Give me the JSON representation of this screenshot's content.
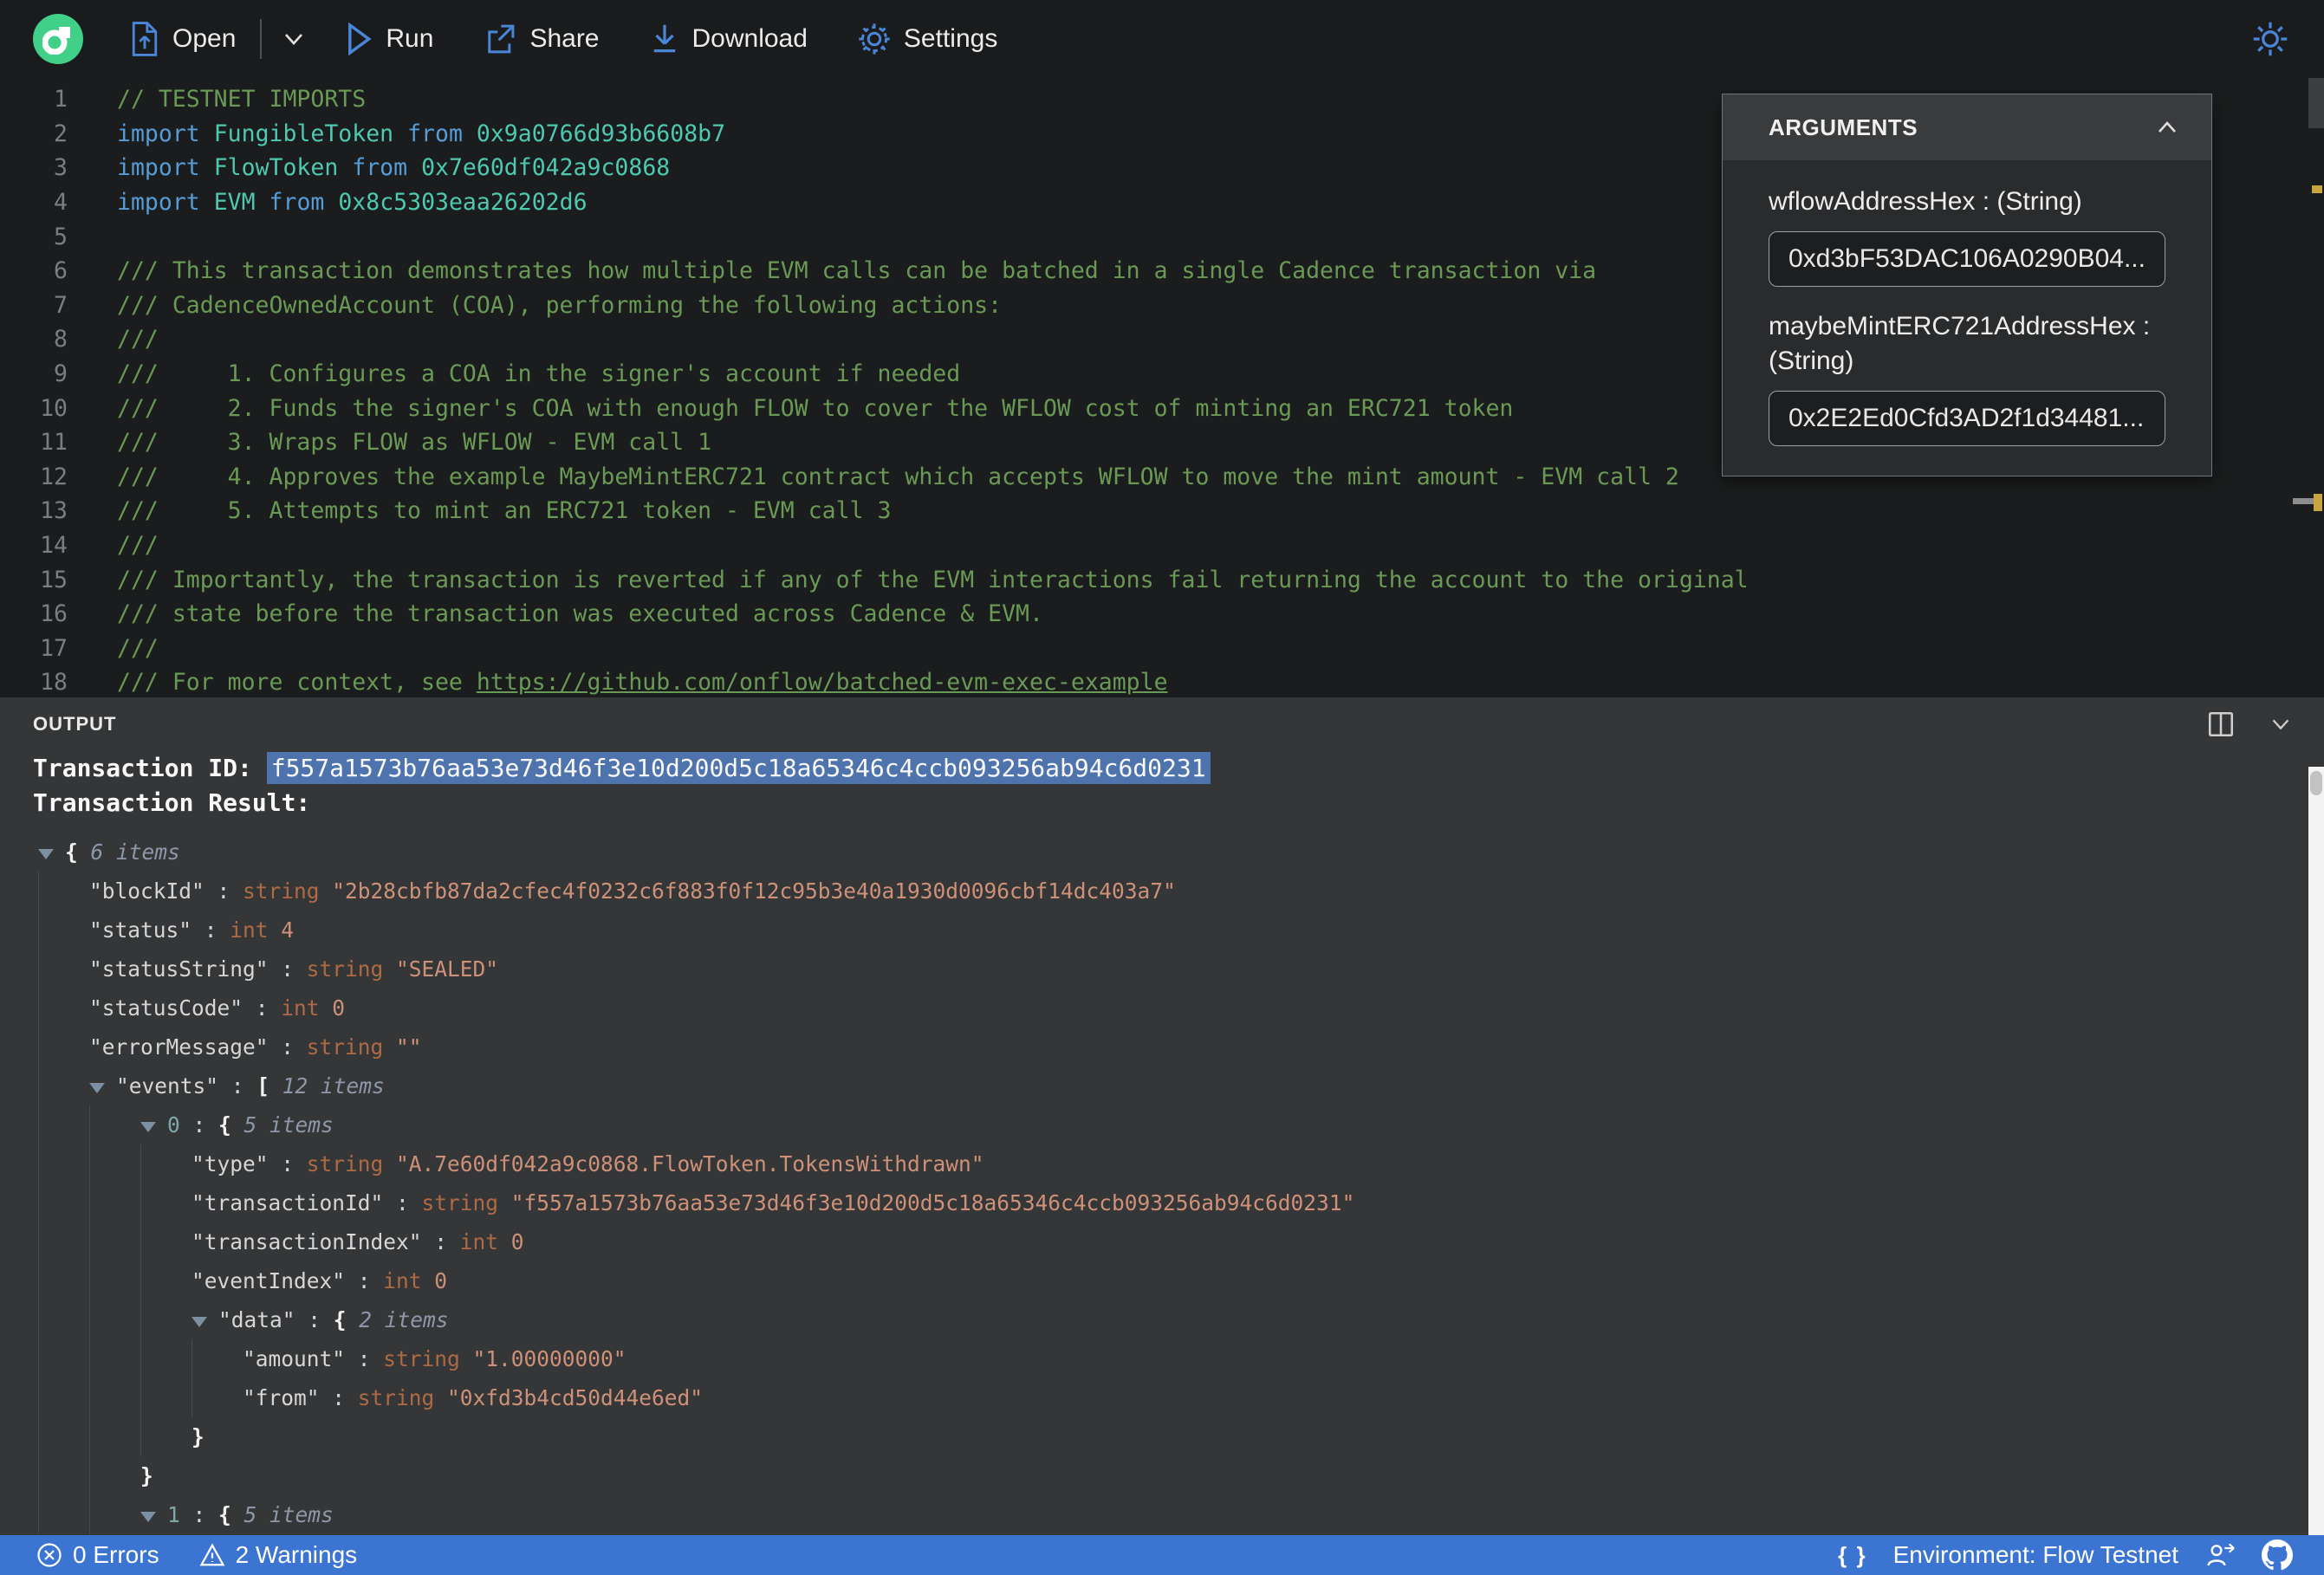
{
  "colors": {
    "accent_blue": "#4a86d8",
    "flow_green": "#41d087",
    "status_bar_blue": "#3b74d1",
    "warning_marker": "#c9a63d",
    "selection_blue": "#4f74ad",
    "comment_green": "#6A9955",
    "keyword_blue": "#569CD6",
    "type_teal": "#4EC9B0",
    "json_string_orange": "#ce9178"
  },
  "toolbar": {
    "open": "Open",
    "run": "Run",
    "share": "Share",
    "download": "Download",
    "settings": "Settings"
  },
  "editor": {
    "lines": [
      {
        "n": "1",
        "toks": [
          [
            "c",
            "// TESTNET IMPORTS"
          ]
        ]
      },
      {
        "n": "2",
        "toks": [
          [
            "k",
            "import"
          ],
          [
            "p",
            " "
          ],
          [
            "t",
            "FungibleToken"
          ],
          [
            "p",
            " "
          ],
          [
            "k",
            "from"
          ],
          [
            "p",
            " "
          ],
          [
            "t",
            "0x9a0766d93b6608b7"
          ]
        ]
      },
      {
        "n": "3",
        "toks": [
          [
            "k",
            "import"
          ],
          [
            "p",
            " "
          ],
          [
            "t",
            "FlowToken"
          ],
          [
            "p",
            " "
          ],
          [
            "k",
            "from"
          ],
          [
            "p",
            " "
          ],
          [
            "t",
            "0x7e60df042a9c0868"
          ]
        ]
      },
      {
        "n": "4",
        "toks": [
          [
            "k",
            "import"
          ],
          [
            "p",
            " "
          ],
          [
            "t",
            "EVM"
          ],
          [
            "p",
            " "
          ],
          [
            "k",
            "from"
          ],
          [
            "p",
            " "
          ],
          [
            "t",
            "0x8c5303eaa26202d6"
          ]
        ]
      },
      {
        "n": "5",
        "toks": []
      },
      {
        "n": "6",
        "toks": [
          [
            "c",
            "/// This transaction demonstrates how multiple EVM calls can be batched in a single Cadence transaction via"
          ]
        ]
      },
      {
        "n": "7",
        "toks": [
          [
            "c",
            "/// CadenceOwnedAccount (COA), performing the following actions:"
          ]
        ]
      },
      {
        "n": "8",
        "toks": [
          [
            "c",
            "///"
          ]
        ]
      },
      {
        "n": "9",
        "toks": [
          [
            "c",
            "///     1. Configures a COA in the signer's account if needed"
          ]
        ]
      },
      {
        "n": "10",
        "toks": [
          [
            "c",
            "///     2. Funds the signer's COA with enough FLOW to cover the WFLOW cost of minting an ERC721 token"
          ]
        ]
      },
      {
        "n": "11",
        "toks": [
          [
            "c",
            "///     3. Wraps FLOW as WFLOW - EVM call 1"
          ]
        ]
      },
      {
        "n": "12",
        "toks": [
          [
            "c",
            "///     4. Approves the example MaybeMintERC721 contract which accepts WFLOW to move the mint amount - EVM call 2"
          ]
        ]
      },
      {
        "n": "13",
        "toks": [
          [
            "c",
            "///     5. Attempts to mint an ERC721 token - EVM call 3"
          ]
        ]
      },
      {
        "n": "14",
        "toks": [
          [
            "c",
            "///"
          ]
        ]
      },
      {
        "n": "15",
        "toks": [
          [
            "c",
            "/// Importantly, the transaction is reverted if any of the EVM interactions fail returning the account to the original"
          ]
        ]
      },
      {
        "n": "16",
        "toks": [
          [
            "c",
            "/// state before the transaction was executed across Cadence & EVM."
          ]
        ]
      },
      {
        "n": "17",
        "toks": [
          [
            "c",
            "///"
          ]
        ]
      },
      {
        "n": "18",
        "toks": [
          [
            "c",
            "/// For more context, see "
          ],
          [
            "cl",
            "https://github.com/onflow/batched-evm-exec-example"
          ]
        ]
      }
    ]
  },
  "arguments_panel": {
    "title": "ARGUMENTS",
    "fields": [
      {
        "label": "wflowAddressHex : (String)",
        "value": "0xd3bF53DAC106A0290B04..."
      },
      {
        "label": "maybeMintERC721AddressHex : (String)",
        "value": "0x2E2Ed0Cfd3AD2f1d34481..."
      }
    ]
  },
  "output": {
    "title": "OUTPUT",
    "tx_id_label": "Transaction ID: ",
    "tx_id": "f557a1573b76aa53e73d46f3e10d200d5c18a65346c4ccb093256ab94c6d0231",
    "tx_result_label": "Transaction Result:",
    "tree": [
      {
        "d": 0,
        "tri": true,
        "seg": [
          [
            "brace",
            "{ "
          ],
          [
            "items",
            "6 items"
          ]
        ]
      },
      {
        "d": 1,
        "seg": [
          [
            "key",
            "\"blockId\""
          ],
          [
            "colon",
            " : "
          ],
          [
            "typ",
            "string "
          ],
          [
            "str",
            "\"2b28cbfb87da2cfec4f0232c6f883f0f12c95b3e40a1930d0096cbf14dc403a7\""
          ]
        ]
      },
      {
        "d": 1,
        "seg": [
          [
            "key",
            "\"status\""
          ],
          [
            "colon",
            " : "
          ],
          [
            "typ",
            "int "
          ],
          [
            "num",
            "4"
          ]
        ]
      },
      {
        "d": 1,
        "seg": [
          [
            "key",
            "\"statusString\""
          ],
          [
            "colon",
            " : "
          ],
          [
            "typ",
            "string "
          ],
          [
            "str",
            "\"SEALED\""
          ]
        ]
      },
      {
        "d": 1,
        "seg": [
          [
            "key",
            "\"statusCode\""
          ],
          [
            "colon",
            " : "
          ],
          [
            "typ",
            "int "
          ],
          [
            "num",
            "0"
          ]
        ]
      },
      {
        "d": 1,
        "seg": [
          [
            "key",
            "\"errorMessage\""
          ],
          [
            "colon",
            " : "
          ],
          [
            "typ",
            "string "
          ],
          [
            "str",
            "\"\""
          ]
        ]
      },
      {
        "d": 1,
        "tri": true,
        "seg": [
          [
            "key",
            "\"events\""
          ],
          [
            "colon",
            " : "
          ],
          [
            "brace",
            "[ "
          ],
          [
            "items",
            "12 items"
          ]
        ]
      },
      {
        "d": 2,
        "tri": true,
        "seg": [
          [
            "idx",
            "0"
          ],
          [
            "colon",
            " : "
          ],
          [
            "brace",
            "{ "
          ],
          [
            "items",
            "5 items"
          ]
        ]
      },
      {
        "d": 3,
        "seg": [
          [
            "key",
            "\"type\""
          ],
          [
            "colon",
            " : "
          ],
          [
            "typ",
            "string "
          ],
          [
            "str",
            "\"A.7e60df042a9c0868.FlowToken.TokensWithdrawn\""
          ]
        ]
      },
      {
        "d": 3,
        "seg": [
          [
            "key",
            "\"transactionId\""
          ],
          [
            "colon",
            " : "
          ],
          [
            "typ",
            "string "
          ],
          [
            "str",
            "\"f557a1573b76aa53e73d46f3e10d200d5c18a65346c4ccb093256ab94c6d0231\""
          ]
        ]
      },
      {
        "d": 3,
        "seg": [
          [
            "key",
            "\"transactionIndex\""
          ],
          [
            "colon",
            " : "
          ],
          [
            "typ",
            "int "
          ],
          [
            "num",
            "0"
          ]
        ]
      },
      {
        "d": 3,
        "seg": [
          [
            "key",
            "\"eventIndex\""
          ],
          [
            "colon",
            " : "
          ],
          [
            "typ",
            "int "
          ],
          [
            "num",
            "0"
          ]
        ]
      },
      {
        "d": 3,
        "tri": true,
        "seg": [
          [
            "key",
            "\"data\""
          ],
          [
            "colon",
            " : "
          ],
          [
            "brace",
            "{ "
          ],
          [
            "items",
            "2 items"
          ]
        ]
      },
      {
        "d": 4,
        "seg": [
          [
            "key",
            "\"amount\""
          ],
          [
            "colon",
            " : "
          ],
          [
            "typ",
            "string "
          ],
          [
            "str",
            "\"1.00000000\""
          ]
        ]
      },
      {
        "d": 4,
        "seg": [
          [
            "key",
            "\"from\""
          ],
          [
            "colon",
            " : "
          ],
          [
            "typ",
            "string "
          ],
          [
            "str",
            "\"0xfd3b4cd50d44e6ed\""
          ]
        ]
      },
      {
        "d": 3,
        "seg": [
          [
            "brace",
            "}"
          ]
        ]
      },
      {
        "d": 2,
        "seg": [
          [
            "brace",
            "}"
          ]
        ]
      },
      {
        "d": 2,
        "tri": true,
        "seg": [
          [
            "idx",
            "1"
          ],
          [
            "colon",
            " : "
          ],
          [
            "brace",
            "{ "
          ],
          [
            "items",
            "5 items"
          ]
        ]
      }
    ]
  },
  "status_bar": {
    "errors": "0 Errors",
    "warnings": "2 Warnings",
    "environment": "Environment: Flow Testnet"
  }
}
